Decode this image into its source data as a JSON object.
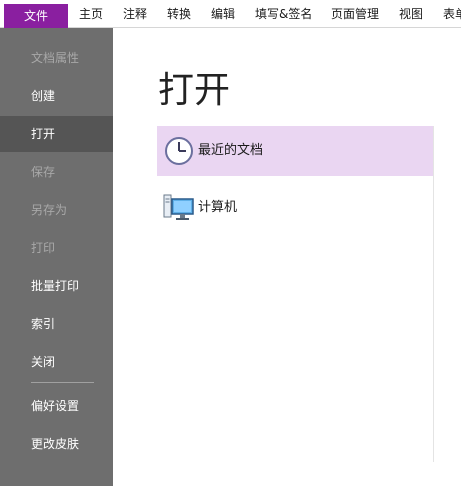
{
  "tabs": [
    "文件",
    "主页",
    "注释",
    "转换",
    "编辑",
    "填写&签名",
    "页面管理",
    "视图",
    "表单"
  ],
  "sidebar": {
    "items": [
      {
        "label": "文档属性",
        "state": "disabled"
      },
      {
        "label": "创建",
        "state": "normal"
      },
      {
        "label": "打开",
        "state": "selected"
      },
      {
        "label": "保存",
        "state": "disabled"
      },
      {
        "label": "另存为",
        "state": "disabled"
      },
      {
        "label": "打印",
        "state": "disabled"
      },
      {
        "label": "批量打印",
        "state": "normal"
      },
      {
        "label": "索引",
        "state": "normal"
      },
      {
        "label": "关闭",
        "state": "normal"
      },
      {
        "label": "偏好设置",
        "state": "normal"
      },
      {
        "label": "更改皮肤",
        "state": "normal"
      }
    ]
  },
  "main": {
    "title": "打开",
    "places": [
      {
        "label": "最近的文档",
        "icon": "clock-icon",
        "selected": true
      },
      {
        "label": "计算机",
        "icon": "computer-icon",
        "selected": false
      }
    ]
  },
  "colors": {
    "file_tab": "#8a1fa0",
    "sidebar_bg": "#6e6e6e",
    "sidebar_selected": "#555555",
    "place_selected": "#ead6f2"
  }
}
